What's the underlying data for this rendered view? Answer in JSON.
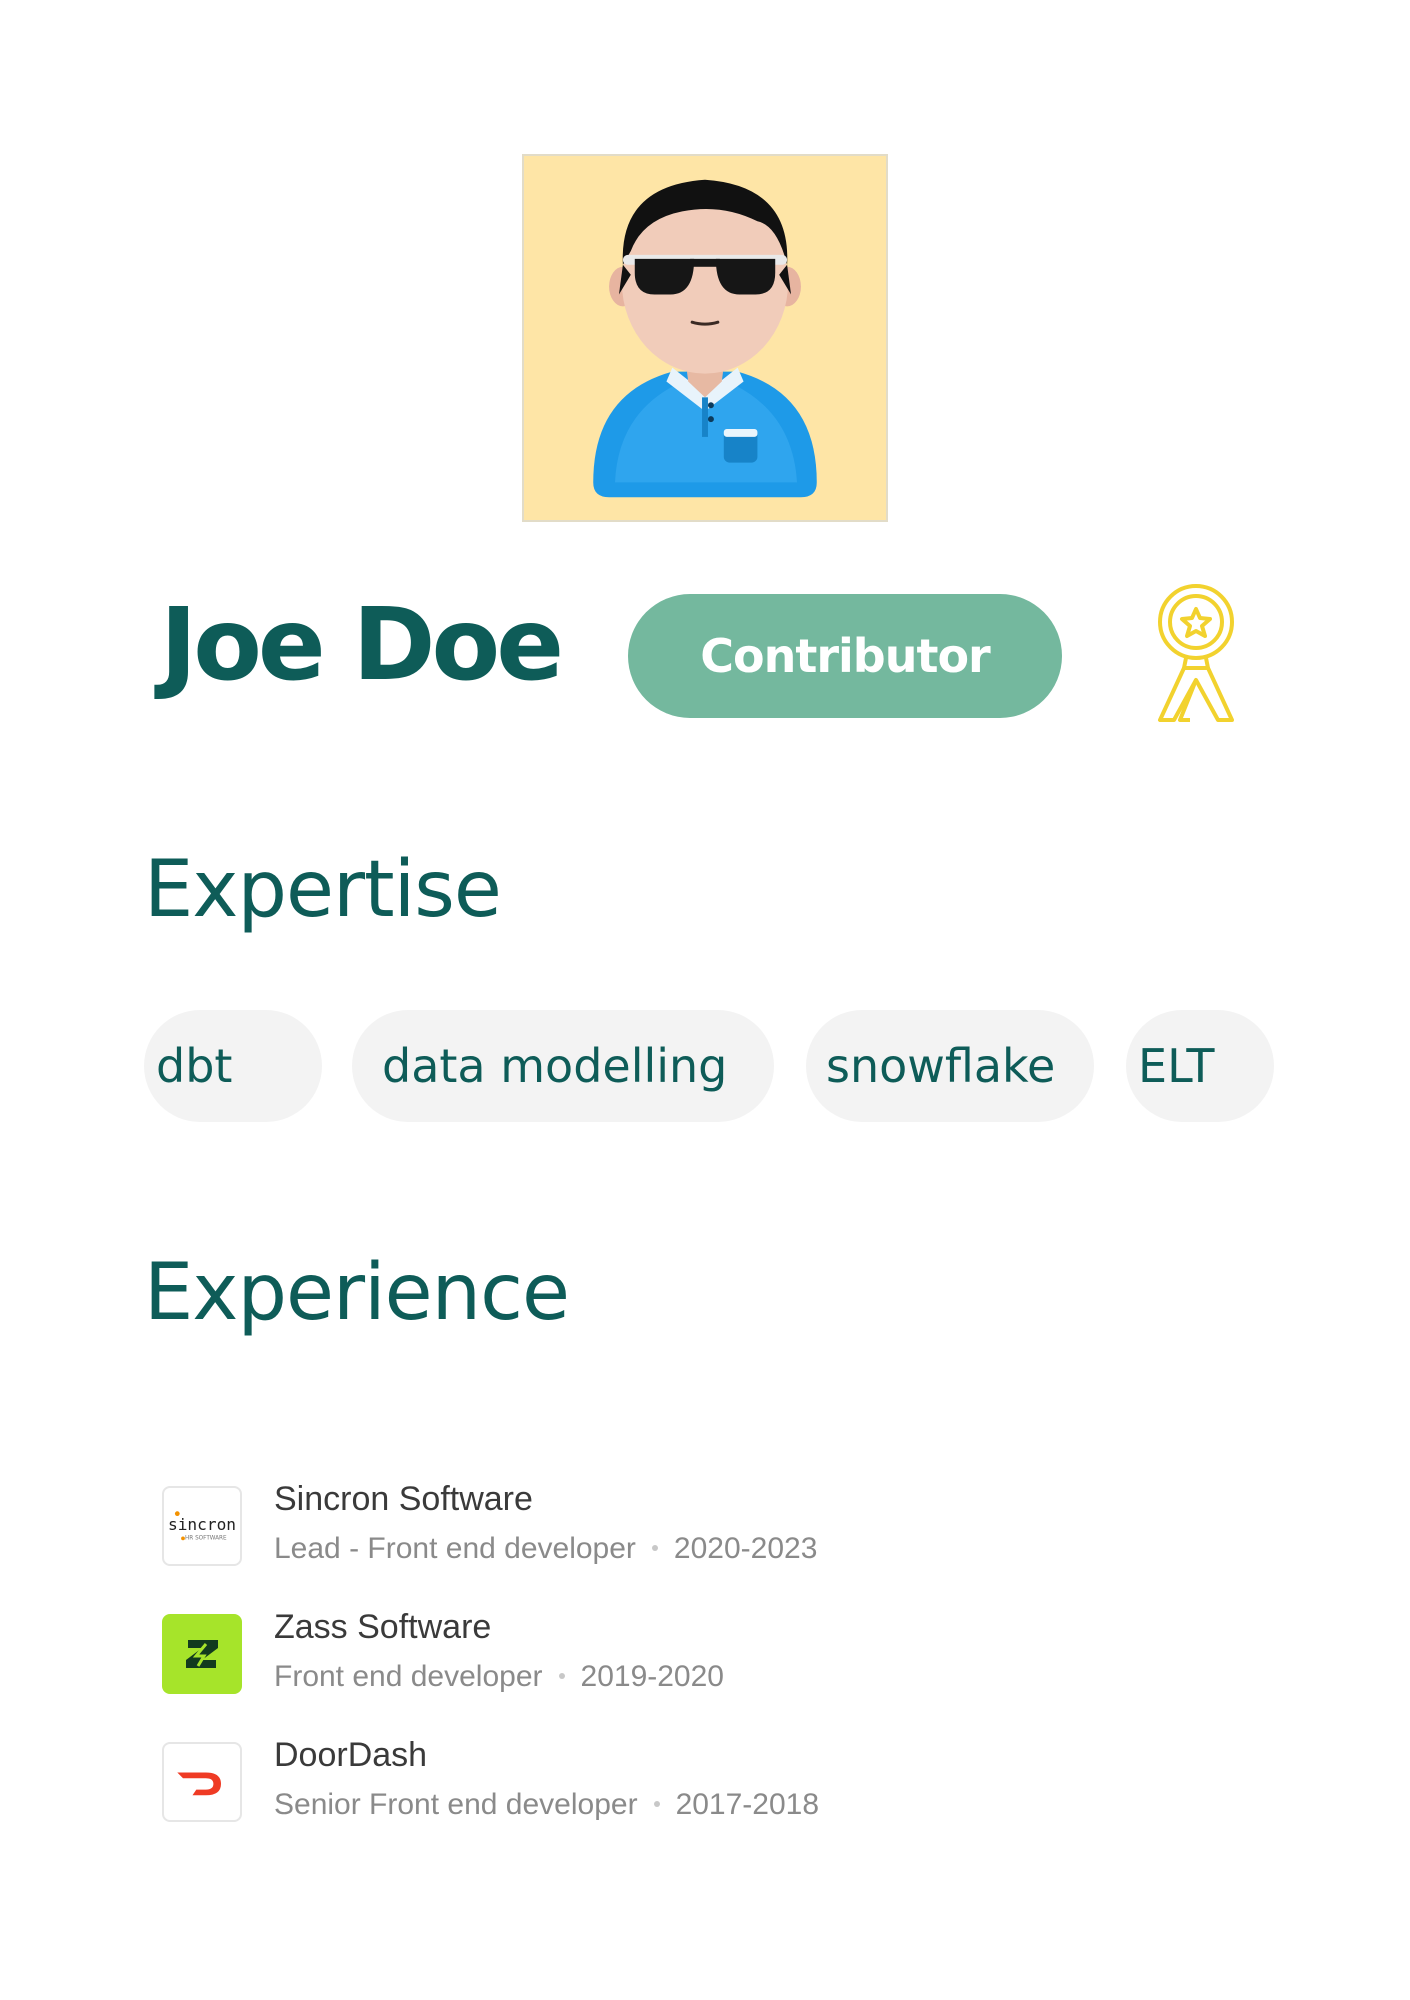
{
  "profile": {
    "name": "Joe Doe",
    "role": "Contributor",
    "avatar_icon": "avatar-3d-man-sunglasses",
    "award_icon": "award-ribbon-icon"
  },
  "colors": {
    "primary_text": "#0e5c58",
    "badge_bg": "#74b89e",
    "chip_bg": "#f3f3f3",
    "avatar_bg": "#fee5a6",
    "award": "#f2d22e"
  },
  "expertise": {
    "title": "Expertise",
    "tags": [
      "dbt",
      "data modelling",
      "snowflake",
      "ELT"
    ]
  },
  "experience": {
    "title": "Experience",
    "jobs": [
      {
        "company": "Sincron Software",
        "role": "Lead - Front end developer",
        "years": "2020-2023",
        "logo_icon": "sincron-logo",
        "logo_text": "sincron",
        "logo_subtext": "HR SOFTWARE"
      },
      {
        "company": "Zass Software",
        "role": "Front end developer",
        "years": "2019-2020",
        "logo_icon": "zass-logo"
      },
      {
        "company": "DoorDash",
        "role": "Senior Front end developer",
        "years": "2017-2018",
        "logo_icon": "doordash-logo"
      }
    ]
  }
}
